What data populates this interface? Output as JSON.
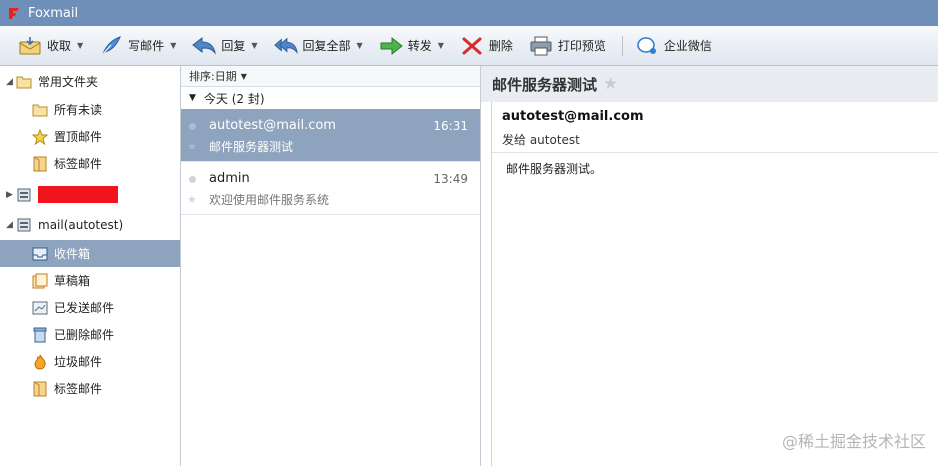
{
  "app": {
    "title": "Foxmail"
  },
  "toolbar": {
    "receive": "收取",
    "compose": "写邮件",
    "reply": "回复",
    "reply_all": "回复全部",
    "forward": "转发",
    "delete": "删除",
    "print_preview": "打印预览",
    "wecom": "企业微信"
  },
  "folders": {
    "favorites": {
      "label": "常用文件夹",
      "items": [
        {
          "label": "所有未读"
        },
        {
          "label": "置顶邮件"
        },
        {
          "label": "标签邮件"
        }
      ]
    },
    "account": {
      "label": "mail(autotest)",
      "items": [
        {
          "label": "收件箱"
        },
        {
          "label": "草稿箱"
        },
        {
          "label": "已发送邮件"
        },
        {
          "label": "已删除邮件"
        },
        {
          "label": "垃圾邮件"
        },
        {
          "label": "标签邮件"
        }
      ]
    }
  },
  "list": {
    "sort_label": "排序:日期",
    "group_label": "今天 (2 封)",
    "messages": [
      {
        "from": "autotest@mail.com",
        "time": "16:31",
        "subject": "邮件服务器测试"
      },
      {
        "from": "admin",
        "time": "13:49",
        "subject": "欢迎使用邮件服务系统"
      }
    ]
  },
  "reader": {
    "subject": "邮件服务器测试",
    "sender": "autotest@mail.com",
    "to_line": "发给 autotest",
    "body": "邮件服务器测试。"
  },
  "watermark": "@稀土掘金技术社区",
  "colors": {
    "titlebar": "#6e8fb8",
    "selection": "#8ea3bd",
    "accent_red": "#f0141e"
  }
}
